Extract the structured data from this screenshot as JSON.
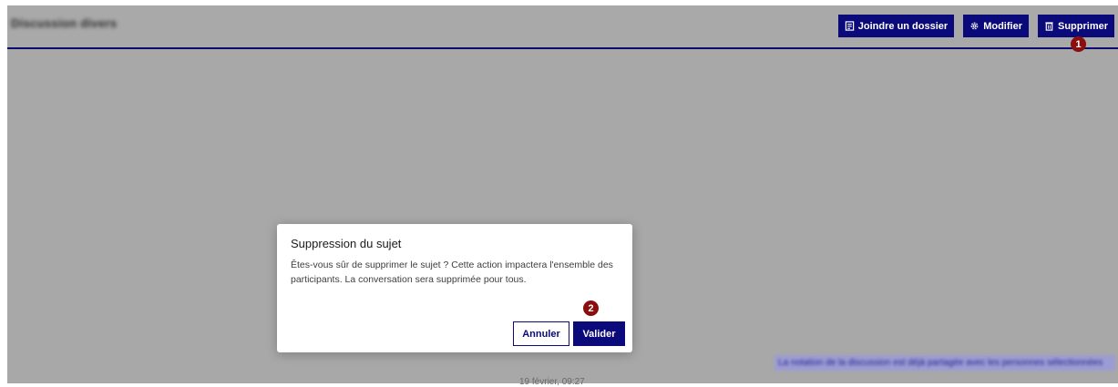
{
  "header": {
    "title": "Discussion divers",
    "buttons": [
      {
        "label": "Joindre un dossier",
        "icon": "attach-folder-icon"
      },
      {
        "label": "Modifier",
        "icon": "gear-icon"
      },
      {
        "label": "Supprimer",
        "icon": "trash-icon"
      }
    ]
  },
  "step_badges": {
    "first": "1",
    "second": "2"
  },
  "dialog": {
    "title": "Suppression du sujet",
    "message": "Êtes-vous sûr de supprimer le sujet ? Cette action impactera l'ensemble des participants. La conversation sera supprimée pour tous.",
    "cancel_label": "Annuler",
    "confirm_label": "Valider"
  },
  "conversation": {
    "blurred_notice": "La notation de la discussion est déjà partagée avec les personnes sélectionnées",
    "timestamp": "19 février, 09:27"
  },
  "colors": {
    "primary": "#0a0a7a",
    "badge": "#8b0e0e",
    "overlay": "#a8a8a8"
  }
}
